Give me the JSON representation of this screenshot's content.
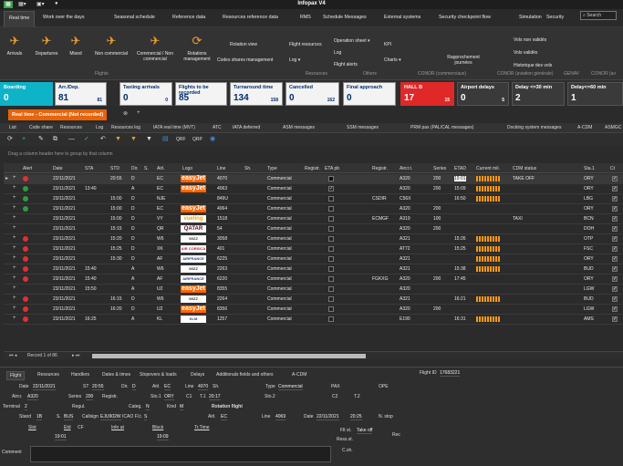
{
  "app": {
    "title": "Infopax V4"
  },
  "menu": {
    "tabs": [
      "Real time",
      "Work over the days",
      "Seasonal schedule",
      "Reference data",
      "Resources reference data",
      "RMS",
      "Schedule Messages",
      "External systems",
      "Security checkpoint flow",
      "Simulation",
      "Security"
    ],
    "search_placeholder": "Search"
  },
  "ribbon": {
    "buttons": [
      "Arrivals",
      "Departures",
      "Mixed",
      "Non commercial",
      "Commercial / Non commercial",
      "Rotations management"
    ],
    "small": {
      "rotation_view": "Rotation view",
      "codes_shares": "Codes shares management",
      "flight_resources": "Flight resources",
      "log_arrow": "Log ▾",
      "operation_sheet": "Operation sheet ▾",
      "log": "Log",
      "flight_alerts": "Flight alerts",
      "kpi": "KPI",
      "charts": "Charts ▾",
      "rapprochement": "Rapprochement journées",
      "vols_non_valides": "Vols non validés",
      "vols_valides": "Vols validés",
      "historique": "Historique des vols"
    },
    "groups": [
      "Flights",
      "Resources",
      "Others",
      "CONOR (commerciaux)",
      "CONOR (aviation générale)",
      "GENAV",
      "CONOR (av"
    ]
  },
  "kpis": [
    {
      "label": "Boarding",
      "value": "0",
      "sub": ""
    },
    {
      "label": "Arr./Dep.",
      "value": "81",
      "sub": "81"
    },
    {
      "label": "Taxiing arrivals",
      "value": "0",
      "sub": "0"
    },
    {
      "label": "Flights to be recorded",
      "value": "85",
      "sub": ""
    },
    {
      "label": "Turnaround time",
      "value": "134",
      "sub": "158"
    },
    {
      "label": "Cancelled",
      "value": "0",
      "sub": "162"
    },
    {
      "label": "Final approach",
      "value": "0",
      "sub": ""
    },
    {
      "label": "HALL B",
      "value": "17",
      "sub": "15"
    },
    {
      "label": "Airport delays",
      "value": "0",
      "sub": "5"
    },
    {
      "label": "Delay <=30 min",
      "value": "2",
      "sub": ""
    },
    {
      "label": "Delay<=60 min",
      "value": "1",
      "sub": ""
    }
  ],
  "doctab": {
    "label": "Real time - Commercial (Not recorded)",
    "close": "⊗",
    "add": "+"
  },
  "subtabs": [
    "List",
    "Code share",
    "Resources",
    "Log",
    "Resources log",
    "IATA real time (MVT)",
    "ATC",
    "IATA deferred",
    "ASM messages",
    "SSM messages",
    "PRM pax (PAL/CAL messages)",
    "Docking system messages",
    "A-CDM",
    "ASMGC"
  ],
  "toolbar": {
    "labels": [
      "QRF",
      "QRP"
    ]
  },
  "grid": {
    "group_hint": "Drag a column header here to group by that column",
    "headers": [
      "Alert",
      "Date",
      "STA",
      "STD",
      "Dir.",
      "S.",
      "Airl.",
      "Logo",
      "Line",
      "Sh.",
      "Type",
      "Registr.",
      "ETA pb",
      "Registr.",
      "Aircr.t.",
      "Series",
      "ETAD",
      "Current mil.",
      "CDM status",
      "Sta.1",
      "Ct"
    ],
    "rows": [
      {
        "alert": "red",
        "date": "22/11/2021",
        "sta": "",
        "std": "20:55",
        "dir": "D",
        "s": "",
        "airl": "EC",
        "logo": "easyJet",
        "logo_style": "easyjet",
        "line": "4070",
        "type": "Commercial",
        "chk": "blk",
        "registr": "",
        "aircr": "A320",
        "series": "200",
        "etad": "19:01",
        "mil": true,
        "cdm": "TAKE OFF",
        "sta1": "ORY",
        "sel": true
      },
      {
        "alert": "green",
        "date": "23/11/2021",
        "sta": "13:40",
        "std": "",
        "dir": "A",
        "s": "",
        "airl": "EC",
        "logo": "easyJet",
        "logo_style": "easyjet",
        "line": "4063",
        "type": "Commercial",
        "chk": "check",
        "registr": "",
        "aircr": "A320",
        "series": "200",
        "etad": "15:09",
        "mil": true,
        "cdm": "",
        "sta1": "ORY",
        "sel": false
      },
      {
        "alert": "green",
        "date": "23/11/2021",
        "sta": "",
        "std": "15:00",
        "dir": "D",
        "s": "",
        "airl": "NJE",
        "logo": "",
        "logo_style": "",
        "line": "849U",
        "type": "Commercial",
        "chk": "",
        "registr": "CSDIR",
        "aircr": "C56X",
        "series": "",
        "etad": "16:50",
        "mil": true,
        "cdm": "",
        "sta1": "LBG",
        "sel": false
      },
      {
        "alert": "green",
        "date": "23/11/2021",
        "sta": "",
        "std": "15:00",
        "dir": "D",
        "s": "",
        "airl": "EC",
        "logo": "easyJet",
        "logo_style": "easyjet",
        "line": "4064",
        "type": "Commercial",
        "chk": "",
        "registr": "",
        "aircr": "A320",
        "series": "200",
        "etad": "",
        "mil": false,
        "cdm": "",
        "sta1": "ORY",
        "sel": false
      },
      {
        "alert": "",
        "date": "23/11/2021",
        "sta": "",
        "std": "15:00",
        "dir": "D",
        "s": "",
        "airl": "VY",
        "logo": "vueling",
        "logo_style": "vueling",
        "line": "1518",
        "type": "Commercial",
        "chk": "",
        "registr": "ECMGF",
        "aircr": "A319",
        "series": "100",
        "etad": "",
        "mil": false,
        "cdm": "TAXI",
        "sta1": "BCN",
        "sel": false
      },
      {
        "alert": "",
        "date": "23/11/2021",
        "sta": "",
        "std": "15:15",
        "dir": "D",
        "s": "",
        "airl": "QR",
        "logo": "QATAR",
        "logo_style": "qatar",
        "line": "54",
        "type": "Commercial",
        "chk": "",
        "registr": "",
        "aircr": "A320",
        "series": "200",
        "etad": "",
        "mil": false,
        "cdm": "",
        "sta1": "DOH",
        "sel": false
      },
      {
        "alert": "red",
        "date": "23/11/2021",
        "sta": "",
        "std": "15:20",
        "dir": "D",
        "s": "",
        "airl": "W6",
        "logo": "WIZZ",
        "logo_style": "plain",
        "line": "3058",
        "type": "Commercial",
        "chk": "",
        "registr": "",
        "aircr": "A321",
        "series": "",
        "etad": "15:26",
        "mil": true,
        "cdm": "",
        "sta1": "OTP",
        "sel": false
      },
      {
        "alert": "red",
        "date": "23/11/2021",
        "sta": "",
        "std": "15:25",
        "dir": "D",
        "s": "",
        "airl": "XK",
        "logo": "AIR CORSICA",
        "logo_style": "red",
        "line": "401",
        "type": "Commercial",
        "chk": "",
        "registr": "",
        "aircr": "AT72",
        "series": "",
        "etad": "15:25",
        "mil": true,
        "cdm": "",
        "sta1": "FSC",
        "sel": false
      },
      {
        "alert": "red",
        "date": "23/11/2021",
        "sta": "",
        "std": "15:30",
        "dir": "D",
        "s": "",
        "airl": "AF",
        "logo": "AIRFRANCE",
        "logo_style": "blue",
        "line": "6225",
        "type": "Commercial",
        "chk": "",
        "registr": "",
        "aircr": "A321",
        "series": "",
        "etad": "",
        "mil": true,
        "cdm": "",
        "sta1": "ORY",
        "sel": false
      },
      {
        "alert": "red",
        "date": "23/11/2021",
        "sta": "15:40",
        "std": "",
        "dir": "A",
        "s": "",
        "airl": "W6",
        "logo": "WIZZ",
        "logo_style": "plain",
        "line": "2263",
        "type": "Commercial",
        "chk": "",
        "registr": "",
        "aircr": "A321",
        "series": "",
        "etad": "15:38",
        "mil": true,
        "cdm": "",
        "sta1": "BUD",
        "sel": false
      },
      {
        "alert": "red",
        "date": "23/11/2021",
        "sta": "15:40",
        "std": "",
        "dir": "A",
        "s": "",
        "airl": "AF",
        "logo": "AIRFRANCE",
        "logo_style": "blue",
        "line": "6220",
        "type": "Commercial",
        "chk": "",
        "registr": "FGKXG",
        "aircr": "A320",
        "series": "200",
        "etad": "17:45",
        "mil": false,
        "cdm": "",
        "sta1": "ORY",
        "sel": false
      },
      {
        "alert": "",
        "date": "23/11/2021",
        "sta": "15:50",
        "std": "",
        "dir": "A",
        "s": "",
        "airl": "U2",
        "logo": "easyJet",
        "logo_style": "easyjet",
        "line": "8355",
        "type": "Commercial",
        "chk": "",
        "registr": "",
        "aircr": "A320",
        "series": "",
        "etad": "",
        "mil": false,
        "cdm": "",
        "sta1": "LGW",
        "sel": false
      },
      {
        "alert": "red",
        "date": "23/11/2021",
        "sta": "",
        "std": "16:15",
        "dir": "D",
        "s": "",
        "airl": "W6",
        "logo": "WIZZ",
        "logo_style": "plain",
        "line": "2264",
        "type": "Commercial",
        "chk": "",
        "registr": "",
        "aircr": "A321",
        "series": "",
        "etad": "16:21",
        "mil": true,
        "cdm": "",
        "sta1": "BUD",
        "sel": false
      },
      {
        "alert": "red",
        "date": "23/11/2021",
        "sta": "",
        "std": "16:20",
        "dir": "D",
        "s": "",
        "airl": "U2",
        "logo": "easyJet",
        "logo_style": "easyjet",
        "line": "8356",
        "type": "Commercial",
        "chk": "",
        "registr": "",
        "aircr": "A320",
        "series": "200",
        "etad": "",
        "mil": false,
        "cdm": "",
        "sta1": "LGW",
        "sel": false
      },
      {
        "alert": "red",
        "date": "23/11/2021",
        "sta": "16:25",
        "std": "",
        "dir": "A",
        "s": "",
        "airl": "KL",
        "logo": "KLM",
        "logo_style": "blue",
        "line": "1257",
        "type": "Commercial",
        "chk": "",
        "registr": "",
        "aircr": "E190",
        "series": "",
        "etad": "16:31",
        "mil": true,
        "cdm": "",
        "sta1": "AMS",
        "sel": false
      }
    ],
    "record_label": "Record 1 of 86"
  },
  "detail": {
    "tabs": [
      "Flight",
      "Resources",
      "Handlers",
      "Dates & times",
      "Stopovers & loads",
      "Delays",
      "Additionals fields and others",
      "A-CDM"
    ],
    "flight_id_label": "Flight ID",
    "flight_id": "17683221",
    "fields": {
      "date_l": "Date",
      "date_v": "22/11/2021",
      "st_l": "ST",
      "st_v": "20:55",
      "dir_l": "Dir.",
      "dir_v": "D",
      "airl_l": "Airl.",
      "airl_v": "EC",
      "line_l": "Line",
      "line_v": "4070",
      "sh_l": "Sh.",
      "type_l": "Type",
      "type_v": "Commercial",
      "pax_l": "PAX",
      "ope_l": "OPE",
      "aircr_l": "Aircr.",
      "aircr_v": "A320",
      "series_l": "Series",
      "series_v": "200",
      "registr_l": "Registr.",
      "sto1_l": "Sto.1",
      "sto1_v": "ORY",
      "c1_l": "C1",
      "t1_l": "T.1",
      "t1_v": "20:17",
      "sto2_l": "Sto.2",
      "c2_l": "C2",
      "t2_l": "T.2",
      "terminal_l": "Terminal",
      "terminal_v": "2",
      "regul_l": "Regul.",
      "categ_l": "Categ.",
      "categ_v": "N",
      "kind_l": "Kind",
      "kind_v": "M",
      "rotation_l": "Rotation flight",
      "stand_l": "Stand",
      "stand_v": "1B",
      "s_l": "S.",
      "s_v": "BUS",
      "callsign_l": "Callsign",
      "callsign_v": "EJU902W",
      "icao_l": "ICAO Fl.t.",
      "icao_v": "S",
      "airl2_l": "Airl.",
      "airl2_v": "EC",
      "line2_l": "Line",
      "line2_v": "4069",
      "date2_l": "Date",
      "date2_v": "22/11/2021",
      "time2_v": "20:25",
      "nstop_l": "N. stop",
      "slot_l": "Slot",
      "etd_l": "Etd",
      "cf_l": "CF",
      "info_l": "Info at",
      "block_l": "Block",
      "trtime_l": "Tr.Time",
      "etd_v": "19:01",
      "block_v": "19:09",
      "flt_l": "Flt st.",
      "flt_v": "Take off",
      "ress_l": "Ress.st.",
      "csh_l": "C.sh.",
      "rec_l": "Rec",
      "comment_l": "Comment"
    }
  },
  "colors": {
    "accent": "#e8630a",
    "kpi_cyan": "#0fb3c8",
    "kpi_red": "#e02828",
    "alert_red": "#e03030",
    "alert_green": "#2f9a3f",
    "easyjet": "#ff6600"
  }
}
